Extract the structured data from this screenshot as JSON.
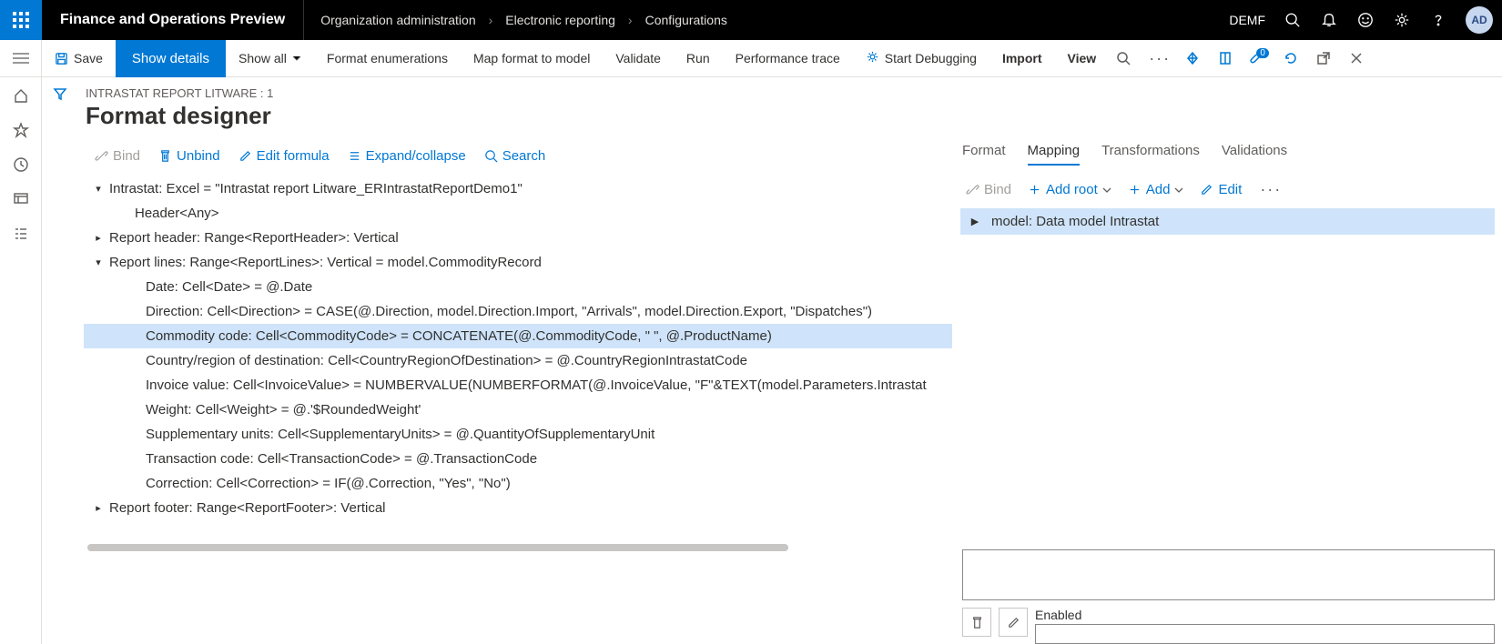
{
  "topbar": {
    "app_title": "Finance and Operations Preview",
    "breadcrumb": [
      "Organization administration",
      "Electronic reporting",
      "Configurations"
    ],
    "company": "DEMF",
    "avatar": "AD"
  },
  "actionpane": {
    "save": "Save",
    "show_details": "Show details",
    "show_all": "Show all",
    "format_enums": "Format enumerations",
    "map_format": "Map format to model",
    "validate": "Validate",
    "run": "Run",
    "perf_trace": "Performance trace",
    "start_debug": "Start Debugging",
    "import": "Import",
    "view": "View",
    "badge_count": "0"
  },
  "main": {
    "report_name": "INTRASTAT REPORT LITWARE : 1",
    "page_title": "Format designer",
    "toolbar": {
      "bind": "Bind",
      "unbind": "Unbind",
      "edit_formula": "Edit formula",
      "expand_collapse": "Expand/collapse",
      "search": "Search"
    }
  },
  "tree": [
    {
      "indent": 0,
      "caret": "down",
      "text": "Intrastat: Excel = \"Intrastat report Litware_ERIntrastatReportDemo1\""
    },
    {
      "indent": 1,
      "caret": "none",
      "text": "Header<Any>"
    },
    {
      "indent": 0,
      "caret": "right",
      "text": "Report header: Range<ReportHeader>: Vertical"
    },
    {
      "indent": 0,
      "caret": "down",
      "text": "Report lines: Range<ReportLines>: Vertical = model.CommodityRecord"
    },
    {
      "indent": 2,
      "caret": "none",
      "text": "Date: Cell<Date> = @.Date"
    },
    {
      "indent": 2,
      "caret": "none",
      "text": "Direction: Cell<Direction> = CASE(@.Direction, model.Direction.Import, \"Arrivals\", model.Direction.Export, \"Dispatches\")"
    },
    {
      "indent": 2,
      "caret": "none",
      "text": "Commodity code: Cell<CommodityCode> = CONCATENATE(@.CommodityCode, \" \", @.ProductName)",
      "selected": true
    },
    {
      "indent": 2,
      "caret": "none",
      "text": "Country/region of destination: Cell<CountryRegionOfDestination> = @.CountryRegionIntrastatCode"
    },
    {
      "indent": 2,
      "caret": "none",
      "text": "Invoice value: Cell<InvoiceValue> = NUMBERVALUE(NUMBERFORMAT(@.InvoiceValue, \"F\"&TEXT(model.Parameters.Intrastat"
    },
    {
      "indent": 2,
      "caret": "none",
      "text": "Weight: Cell<Weight> = @.'$RoundedWeight'"
    },
    {
      "indent": 2,
      "caret": "none",
      "text": "Supplementary units: Cell<SupplementaryUnits> = @.QuantityOfSupplementaryUnit"
    },
    {
      "indent": 2,
      "caret": "none",
      "text": "Transaction code: Cell<TransactionCode> = @.TransactionCode"
    },
    {
      "indent": 2,
      "caret": "none",
      "text": "Correction: Cell<Correction> = IF(@.Correction, \"Yes\", \"No\")"
    },
    {
      "indent": 0,
      "caret": "right",
      "text": "Report footer: Range<ReportFooter>: Vertical"
    }
  ],
  "mapping": {
    "tabs": [
      "Format",
      "Mapping",
      "Transformations",
      "Validations"
    ],
    "active_tab": "Mapping",
    "toolbar": {
      "bind": "Bind",
      "add_root": "Add root",
      "add": "Add",
      "edit": "Edit"
    },
    "model_node": "model: Data model Intrastat",
    "binding_value": "",
    "enabled_label": "Enabled",
    "enabled_value": ""
  }
}
